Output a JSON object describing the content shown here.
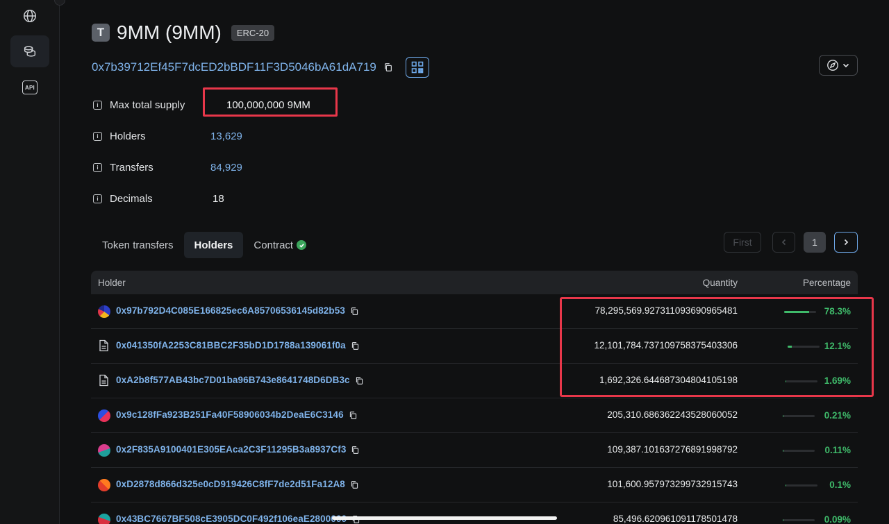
{
  "sidebar": {
    "api_label": "API"
  },
  "token": {
    "icon_letter": "T",
    "title": "9MM (9MM)",
    "standard": "ERC-20",
    "address": "0x7b39712Ef45F7dcED2bBDF11F3D5046bA61dA719"
  },
  "info": {
    "max_supply_label": "Max total supply",
    "max_supply_value": "100,000,000 9MM",
    "holders_label": "Holders",
    "holders_value": "13,629",
    "transfers_label": "Transfers",
    "transfers_value": "84,929",
    "decimals_label": "Decimals",
    "decimals_value": "18"
  },
  "tabs": {
    "transfers": "Token transfers",
    "holders": "Holders",
    "contract": "Contract"
  },
  "pagination": {
    "first": "First",
    "page": "1"
  },
  "table": {
    "col_holder": "Holder",
    "col_quantity": "Quantity",
    "col_percentage": "Percentage",
    "rows": [
      {
        "address": "0x97b792D4C085E166825ec6A85706536145d82b53",
        "quantity": "78,295,569.927311093690965481",
        "percentage": "78.3%",
        "fraction": 0.783,
        "avatar": "pie"
      },
      {
        "address": "0x041350fA2253C81BBC2F35bD1D1788a139061f0a",
        "quantity": "12,101,784.737109758375403306",
        "percentage": "12.1%",
        "fraction": 0.121,
        "avatar": "doc"
      },
      {
        "address": "0xA2b8f577AB43bc7D01ba96B743e8641748D6DB3c",
        "quantity": "1,692,326.644687304804105198",
        "percentage": "1.69%",
        "fraction": 0.0169,
        "avatar": "doc"
      },
      {
        "address": "0x9c128fFa923B251Fa40F58906034b2DeaE6C3146",
        "quantity": "205,310.686362243528060052",
        "percentage": "0.21%",
        "fraction": 0.0021,
        "avatar": "blue-red"
      },
      {
        "address": "0x2F835A9100401E305EAca2C3F11295B3a8937Cf3",
        "quantity": "109,387.101637276891998792",
        "percentage": "0.11%",
        "fraction": 0.0011,
        "avatar": "pink-teal"
      },
      {
        "address": "0xD2878d866d325e0cD919426C8fF7de2d51Fa12A8",
        "quantity": "101,600.957973299732915743",
        "percentage": "0.1%",
        "fraction": 0.001,
        "avatar": "red-orange"
      },
      {
        "address": "0x43BC7667BF508cE3905DC0F492f106eaE2800000",
        "quantity": "85,496.620961091178501478",
        "percentage": "0.09%",
        "fraction": 0.0009,
        "avatar": "teal-red"
      }
    ]
  }
}
